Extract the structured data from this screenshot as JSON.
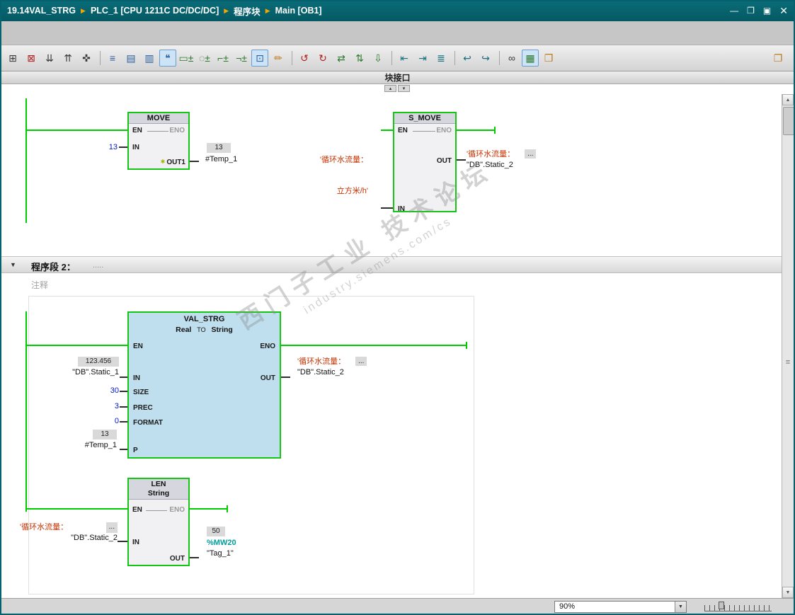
{
  "window": {
    "title_segments": [
      "19.14VAL_STRG",
      "PLC_1 [CPU 1211C DC/DC/DC]",
      "程序块",
      "Main [OB1]"
    ],
    "separator": "▶",
    "controls": {
      "minimize": "—",
      "restore": "❐",
      "maximize": "▣",
      "close": "✕"
    }
  },
  "toolbar": {
    "icons": [
      {
        "name": "insert-network-icon",
        "glyph": "⊞"
      },
      {
        "name": "delete-network-icon",
        "glyph": "⊠"
      },
      {
        "name": "expand-all-networks-icon",
        "glyph": "⇊"
      },
      {
        "name": "collapse-all-networks-icon",
        "glyph": "⇈"
      },
      {
        "name": "pin-window-icon",
        "glyph": "✜"
      },
      {
        "name": "absolute-operands-icon",
        "glyph": "≡"
      },
      {
        "name": "network-titles-icon",
        "glyph": "▤"
      },
      {
        "name": "network-comments-icon",
        "glyph": "▥"
      },
      {
        "name": "comment-toggle-icon",
        "glyph": "❝"
      },
      {
        "name": "empty-box-icon",
        "glyph": "▭±"
      },
      {
        "name": "coil-icon",
        "glyph": "◌±"
      },
      {
        "name": "open-branch-icon",
        "glyph": "⌐±"
      },
      {
        "name": "close-branch-icon",
        "glyph": "¬±"
      },
      {
        "name": "box-frame-icon",
        "glyph": "⊡"
      },
      {
        "name": "favorites-icon",
        "glyph": "✏"
      },
      {
        "name": "goto-prev-error-icon",
        "glyph": "↺"
      },
      {
        "name": "goto-next-error-icon",
        "glyph": "↻"
      },
      {
        "name": "update-block-calls-icon",
        "glyph": "⇄"
      },
      {
        "name": "sync-interface-icon",
        "glyph": "⇅"
      },
      {
        "name": "download-icon",
        "glyph": "⇩"
      },
      {
        "name": "goto-usage-icon",
        "glyph": "⇤"
      },
      {
        "name": "goto-definition-icon",
        "glyph": "⇥"
      },
      {
        "name": "call-structure-icon",
        "glyph": "≣"
      },
      {
        "name": "navigate-back-icon",
        "glyph": "↩"
      },
      {
        "name": "navigate-forward-icon",
        "glyph": "↪"
      },
      {
        "name": "monitoring-glasses-icon",
        "glyph": "∞"
      },
      {
        "name": "monitor-toggle-icon",
        "glyph": "▦"
      },
      {
        "name": "snapshot-icon",
        "glyph": "❒"
      }
    ],
    "right_icon": {
      "name": "editor-layout-icon",
      "glyph": "❐"
    }
  },
  "interface_bar": {
    "label": "块接口",
    "collapse_up": "▴",
    "collapse_down": "▾"
  },
  "editor": {
    "network1": {
      "move": {
        "title": "MOVE",
        "pin_en": "EN",
        "pin_eno": "ENO",
        "pin_in": "IN",
        "pin_out1": "OUT1",
        "modify_icon": "✱",
        "in_value": "13",
        "out_monitor": "13",
        "out_operand": "#Temp_1"
      },
      "smove": {
        "title": "S_MOVE",
        "pin_en": "EN",
        "pin_eno": "ENO",
        "pin_out": "OUT",
        "pin_in": "IN",
        "out_string": "'循环水流量：",
        "out_ellipsis": "...",
        "out_operand": "\"DB\".Static_2",
        "in_string_1": "'循环水流量：",
        "in_string_2": "立方米/h'"
      }
    },
    "network2": {
      "collapse_arrow": "▼",
      "title": "程序段 2：",
      "title_dots": ".....",
      "comment": "注释",
      "valstrg": {
        "title": "VAL_STRG",
        "type_real": "Real",
        "type_to": "TO",
        "type_string": "String",
        "pin_en": "EN",
        "pin_eno": "ENO",
        "pin_in": "IN",
        "pin_out": "OUT",
        "pin_size": "SIZE",
        "pin_prec": "PREC",
        "pin_format": "FORMAT",
        "pin_p": "P",
        "in_monitor": "123.456",
        "in_operand": "\"DB\".Static_1",
        "size_value": "30",
        "prec_value": "3",
        "format_value": "0",
        "p_monitor": "13",
        "p_operand": "#Temp_1",
        "out_string": "'循环水流量：",
        "out_ellipsis": "...",
        "out_operand": "\"DB\".Static_2"
      },
      "len": {
        "title": "LEN",
        "subtitle": "String",
        "pin_en": "EN",
        "pin_eno": "ENO",
        "pin_in": "IN",
        "pin_out": "OUT",
        "in_string": "'循环水流量：",
        "in_ellipsis": "...",
        "in_operand": "\"DB\".Static_2",
        "out_monitor": "50",
        "out_address": "%MW20",
        "out_operand": "\"Tag_1\""
      }
    }
  },
  "watermark": {
    "line1": "西门子工业 技术论坛",
    "line2": "industry.siemens.com/cs"
  },
  "scrollbar": {
    "up": "▲",
    "down": "▼",
    "grip": "≡"
  },
  "status_bar": {
    "zoom_value": "90%",
    "dropdown_arrow": "▼"
  },
  "colors": {
    "wire_green": "#00cc00",
    "block_border_green": "#15c615",
    "string_red": "#c83200",
    "const_blue": "#0018c8",
    "address_teal": "#009c9c",
    "selected_fill": "#bfdfee"
  }
}
